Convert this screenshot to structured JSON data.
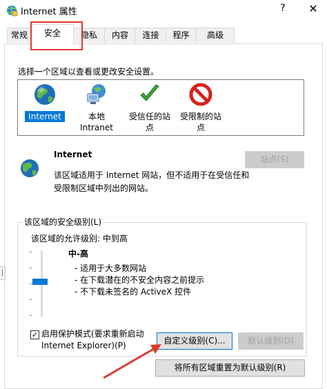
{
  "window": {
    "title": "Internet 属性",
    "help_label": "?",
    "close_label": "✕"
  },
  "tabs": [
    {
      "label": "常规"
    },
    {
      "label": "安全"
    },
    {
      "label": "隐私"
    },
    {
      "label": "内容"
    },
    {
      "label": "连接"
    },
    {
      "label": "程序"
    },
    {
      "label": "高级"
    }
  ],
  "active_tab": "安全",
  "security": {
    "zone_prompt": "选择一个区域以查看或更改安全设置。",
    "zones": [
      {
        "label": "Internet",
        "icon": "globe-icon"
      },
      {
        "label": "本地\nIntranet",
        "icon": "intranet-icon"
      },
      {
        "label": "受信任的站\n点",
        "icon": "checkmark-icon"
      },
      {
        "label": "受限制的站\n点",
        "icon": "restricted-icon"
      }
    ],
    "selected_zone": "Internet",
    "detail": {
      "title": "Internet",
      "description": "该区域适用于 Internet 网站，但不适用于在受信任和受限制区域中列出的网站。",
      "sites_button": "站点(S)"
    },
    "level": {
      "group_title": "该区域的安全级别(L)",
      "allowed": "该区域的允许级别: 中到高",
      "name": "中-高",
      "points": [
        "- 适用于大多数网站",
        "- 在下载潜在的不安全内容之前提示",
        "- 不下载未签名的 ActiveX 控件"
      ]
    },
    "protected_mode": {
      "label": "启用保护模式(要求重新启动 Internet Explorer)(P)",
      "checked": true
    },
    "custom_level_button": "自定义级别(C)...",
    "default_level_button": "默认级别(D)",
    "reset_all_button": "将所有区域重置为默认级别(R)"
  },
  "colors": {
    "accent": "#0078d7",
    "annotation": "#e03a2f"
  }
}
